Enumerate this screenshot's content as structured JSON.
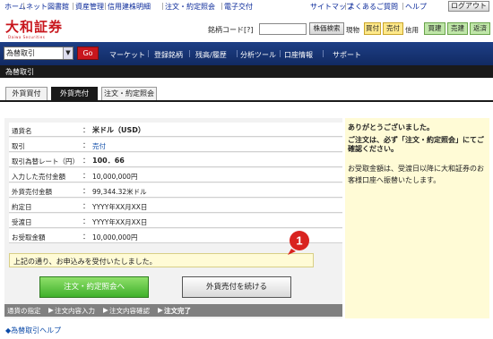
{
  "top_links": [
    "ホーム",
    "ネット図書館",
    "資産管理",
    "信用建株明細",
    "注文・約定照会",
    "電子交付"
  ],
  "right_links": [
    "サイトマップ",
    "よくあるご質問",
    "ヘルプ"
  ],
  "logout_label": "ログアウト",
  "logo": {
    "main": "大和証券",
    "sub": "Daiwa Securities"
  },
  "stock_search": {
    "label": "銘柄コード[?]",
    "value": "",
    "button": "株価検索"
  },
  "quick_trade": {
    "genbutsu_label": "現物",
    "buy": "買付",
    "sell": "売付",
    "shinyo_label": "信用",
    "shin_buy": "買建",
    "shin_sell": "売建",
    "repay": "返済"
  },
  "main_nav": {
    "select_value": "為替取引",
    "go": "Go",
    "items": [
      "マーケット",
      "登録銘柄",
      "残高/履歴",
      "分析ツール",
      "口座情報",
      "サポート"
    ]
  },
  "page_title": "為替取引",
  "tabs": [
    "外貨買付",
    "外貨売付",
    "注文・約定照会"
  ],
  "order": {
    "rows": [
      {
        "label": "通貨名",
        "value": "米ドル（USD）",
        "style": "bold"
      },
      {
        "label": "取引",
        "value": "売付",
        "style": "link"
      },
      {
        "label": "取引為替レート（円）",
        "value": "100．66",
        "style": "bold"
      },
      {
        "label": "入力した売付金額",
        "value": "10,000,000円",
        "style": ""
      },
      {
        "label": "外貨売付金額",
        "value": "99,344.32米ドル",
        "style": ""
      },
      {
        "label": "約定日",
        "value": "YYYY年XX月XX日",
        "style": ""
      },
      {
        "label": "受渡日",
        "value": "YYYY年XX月XX日",
        "style": ""
      },
      {
        "label": "お受取金額",
        "value": "10,000,000円",
        "style": ""
      }
    ],
    "colon": "："
  },
  "message": "上記の通り、お申込みを受付いたしました。",
  "buttons": {
    "inquiry": "注文・約定照会へ",
    "continue": "外貨売付を続ける"
  },
  "steps": [
    "通貨の指定",
    "注文内容入力",
    "注文内容確認",
    "注文完了"
  ],
  "help_link": "◆為替取引ヘルプ",
  "side_panel": {
    "thanks": "ありがとうございました。",
    "confirm": "ご注文は、必ず「注文・約定照会」にてご確認ください。",
    "note": "お受取金額は、受渡日以降に大和証券のお客様口座へ振替いたします。"
  },
  "callout_number": "1",
  "colors": {
    "brand_red": "#c8161d",
    "nav_blue": "#1e3f86",
    "callout_red": "#d9231f",
    "yellow_panel": "#fffbd6"
  }
}
